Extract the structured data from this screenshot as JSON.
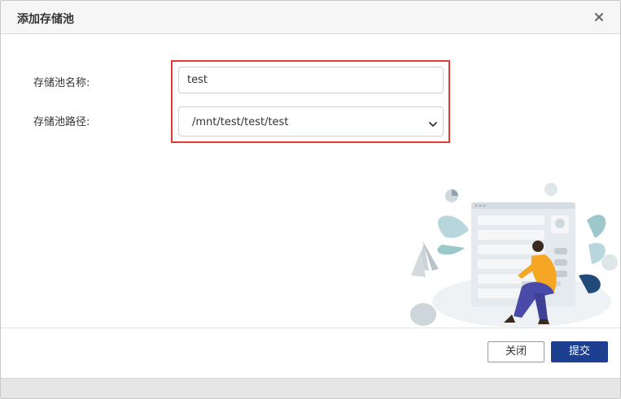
{
  "dialog": {
    "title": "添加存储池",
    "close_icon": "close-icon"
  },
  "form": {
    "name_label": "存储池名称:",
    "name_value": "test",
    "path_label": "存储池路径:",
    "path_value": "/mnt/test/test/test",
    "path_icon": "chevron-down-icon"
  },
  "footer": {
    "close_label": "关闭",
    "submit_label": "提交"
  },
  "colors": {
    "highlight": "#e53935",
    "primary": "#1c3f8f",
    "person_shirt": "#f5a623",
    "person_pants": "#4a4aa8"
  }
}
